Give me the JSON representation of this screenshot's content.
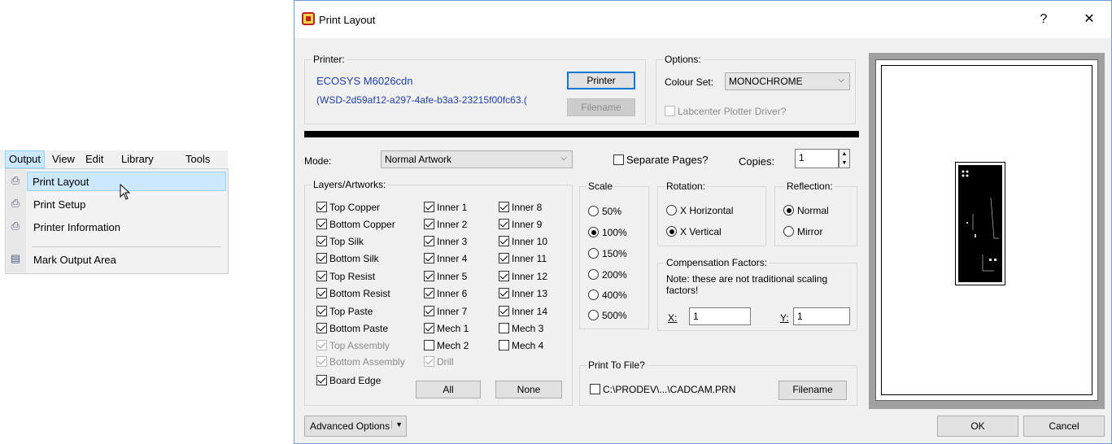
{
  "menu": {
    "bar": [
      "Output",
      "View",
      "Edit",
      "Library",
      "Tools"
    ],
    "items": [
      {
        "label": "Print Layout",
        "icon": "print-layout-icon"
      },
      {
        "label": "Print Setup",
        "icon": "print-setup-icon"
      },
      {
        "label": "Printer Information",
        "icon": "printer-info-icon"
      },
      {
        "label": "Mark Output Area",
        "icon": "mark-output-icon"
      }
    ]
  },
  "dialog": {
    "title": "Print Layout",
    "help": "?",
    "close": "✕",
    "printer": {
      "label": "Printer:",
      "name": "ECOSYS M6026cdn",
      "port": "(WSD-2d59af12-a297-4afe-b3a3-23215f00fc63.(",
      "printer_button": "Printer",
      "filename_button": "Filename"
    },
    "options": {
      "label": "Options:",
      "colour_set_label": "Colour Set:",
      "colour_set_value": "MONOCHROME",
      "plotter_driver": "Labcenter Plotter Driver?"
    },
    "mode": {
      "label": "Mode:",
      "value": "Normal Artwork",
      "separate_pages": "Separate Pages?",
      "copies_label": "Copies:",
      "copies_value": "1"
    },
    "layers": {
      "label": "Layers/Artworks:",
      "col1": [
        {
          "label": "Top Copper",
          "checked": true,
          "disabled": false
        },
        {
          "label": "Bottom Copper",
          "checked": true,
          "disabled": false
        },
        {
          "label": "Top Silk",
          "checked": true,
          "disabled": false
        },
        {
          "label": "Bottom Silk",
          "checked": true,
          "disabled": false
        },
        {
          "label": "Top Resist",
          "checked": true,
          "disabled": false
        },
        {
          "label": "Bottom Resist",
          "checked": true,
          "disabled": false
        },
        {
          "label": "Top Paste",
          "checked": true,
          "disabled": false
        },
        {
          "label": "Bottom Paste",
          "checked": true,
          "disabled": false
        },
        {
          "label": "Top Assembly",
          "checked": true,
          "disabled": true
        },
        {
          "label": "Bottom Assembly",
          "checked": true,
          "disabled": true
        },
        {
          "label": "Board Edge",
          "checked": true,
          "disabled": false
        }
      ],
      "col2": [
        {
          "label": "Inner 1",
          "checked": true,
          "disabled": false
        },
        {
          "label": "Inner 2",
          "checked": true,
          "disabled": false
        },
        {
          "label": "Inner 3",
          "checked": true,
          "disabled": false
        },
        {
          "label": "Inner 4",
          "checked": true,
          "disabled": false
        },
        {
          "label": "Inner 5",
          "checked": true,
          "disabled": false
        },
        {
          "label": "Inner 6",
          "checked": true,
          "disabled": false
        },
        {
          "label": "Inner 7",
          "checked": true,
          "disabled": false
        },
        {
          "label": "Mech 1",
          "checked": true,
          "disabled": false
        },
        {
          "label": "Mech 2",
          "checked": false,
          "disabled": false
        },
        {
          "label": "Drill",
          "checked": true,
          "disabled": true
        }
      ],
      "col3": [
        {
          "label": "Inner 8",
          "checked": true,
          "disabled": false
        },
        {
          "label": "Inner 9",
          "checked": true,
          "disabled": false
        },
        {
          "label": "Inner 10",
          "checked": true,
          "disabled": false
        },
        {
          "label": "Inner 11",
          "checked": true,
          "disabled": false
        },
        {
          "label": "Inner 12",
          "checked": true,
          "disabled": false
        },
        {
          "label": "Inner 13",
          "checked": true,
          "disabled": false
        },
        {
          "label": "Inner 14",
          "checked": true,
          "disabled": false
        },
        {
          "label": "Mech 3",
          "checked": false,
          "disabled": false
        },
        {
          "label": "Mech 4",
          "checked": false,
          "disabled": false
        }
      ],
      "all_button": "All",
      "none_button": "None"
    },
    "scale": {
      "label": "Scale",
      "options": [
        "50%",
        "100%",
        "150%",
        "200%",
        "400%",
        "500%"
      ],
      "selected": "100%"
    },
    "rotation": {
      "label": "Rotation:",
      "options": [
        "X Horizontal",
        "X Vertical"
      ],
      "selected": "X Vertical"
    },
    "reflection": {
      "label": "Reflection:",
      "options": [
        "Normal",
        "Mirror"
      ],
      "selected": "Normal"
    },
    "compensation": {
      "label": "Compensation Factors:",
      "note": "Note: these are not traditional scaling factors!",
      "x_label": "X:",
      "x_value": "1",
      "y_label": "Y:",
      "y_value": "1"
    },
    "print_to_file": {
      "label": "Print To File?",
      "path": "C:\\PRODEV\\...\\CADCAM.PRN",
      "filename_button": "Filename"
    },
    "advanced_button": "Advanced Options",
    "ok_button": "OK",
    "cancel_button": "Cancel"
  },
  "colors": {
    "printer_text": "#1f3fa8",
    "selection": "#cce8ff",
    "focus": "#0078d7"
  }
}
